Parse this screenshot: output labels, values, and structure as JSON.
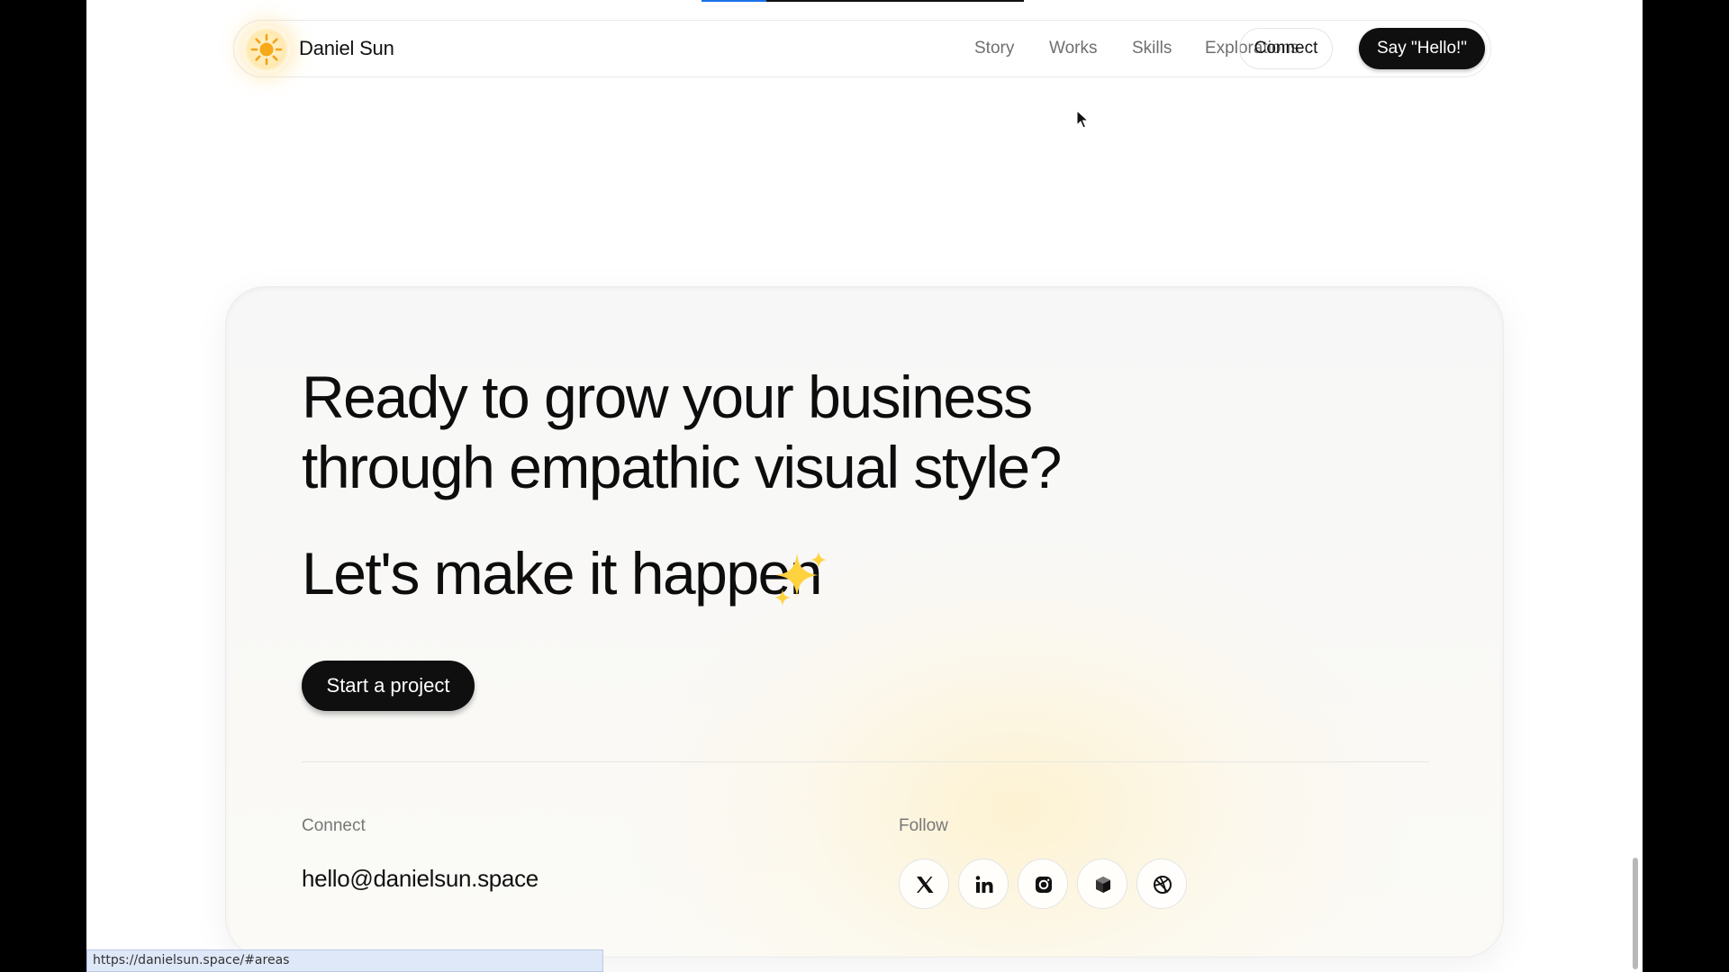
{
  "scroll_progress": 0.2,
  "nav": {
    "brand": "Daniel Sun",
    "links": [
      "Story",
      "Works",
      "Skills",
      "Explorations"
    ],
    "connect": "Connect",
    "cta": "Say \"Hello!\""
  },
  "cta": {
    "headline_line1": "Ready to grow your business",
    "headline_line2": "through empathic visual style?",
    "subheadline": "Let's make it happen",
    "button": "Start a project"
  },
  "footer": {
    "connect_label": "Connect",
    "email": "hello@danielsun.space",
    "follow_label": "Follow",
    "socials": [
      "x-icon",
      "linkedin-icon",
      "instagram-icon",
      "cube-icon",
      "dribbble-icon"
    ]
  },
  "statusbar": {
    "url": "https://danielsun.space/#areas"
  },
  "colors": {
    "accent_sun": "#f6a21a",
    "button_bg": "#0f0f0f",
    "progress": "#1a73e8"
  }
}
